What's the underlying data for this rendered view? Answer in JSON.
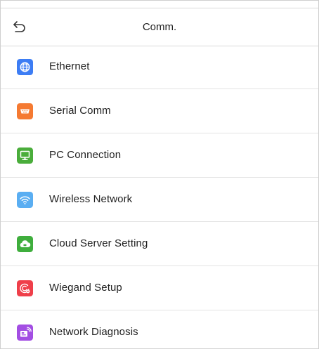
{
  "header": {
    "title": "Comm.",
    "back_icon": "back-arrow-icon"
  },
  "menu": {
    "items": [
      {
        "label": "Ethernet",
        "icon": "globe-icon",
        "color": "#3d7df4"
      },
      {
        "label": "Serial Comm",
        "icon": "serial-port-icon",
        "color": "#f57a32"
      },
      {
        "label": "PC Connection",
        "icon": "monitor-icon",
        "color": "#4aad3b"
      },
      {
        "label": "Wireless Network",
        "icon": "wifi-icon",
        "color": "#5aaef2"
      },
      {
        "label": "Cloud Server Setting",
        "icon": "cloud-icon",
        "color": "#3fae3d"
      },
      {
        "label": "Wiegand Setup",
        "icon": "wiegand-icon",
        "color": "#ef3f4a"
      },
      {
        "label": "Network Diagnosis",
        "icon": "network-diagnosis-icon",
        "color": "#a34ee3"
      }
    ]
  }
}
